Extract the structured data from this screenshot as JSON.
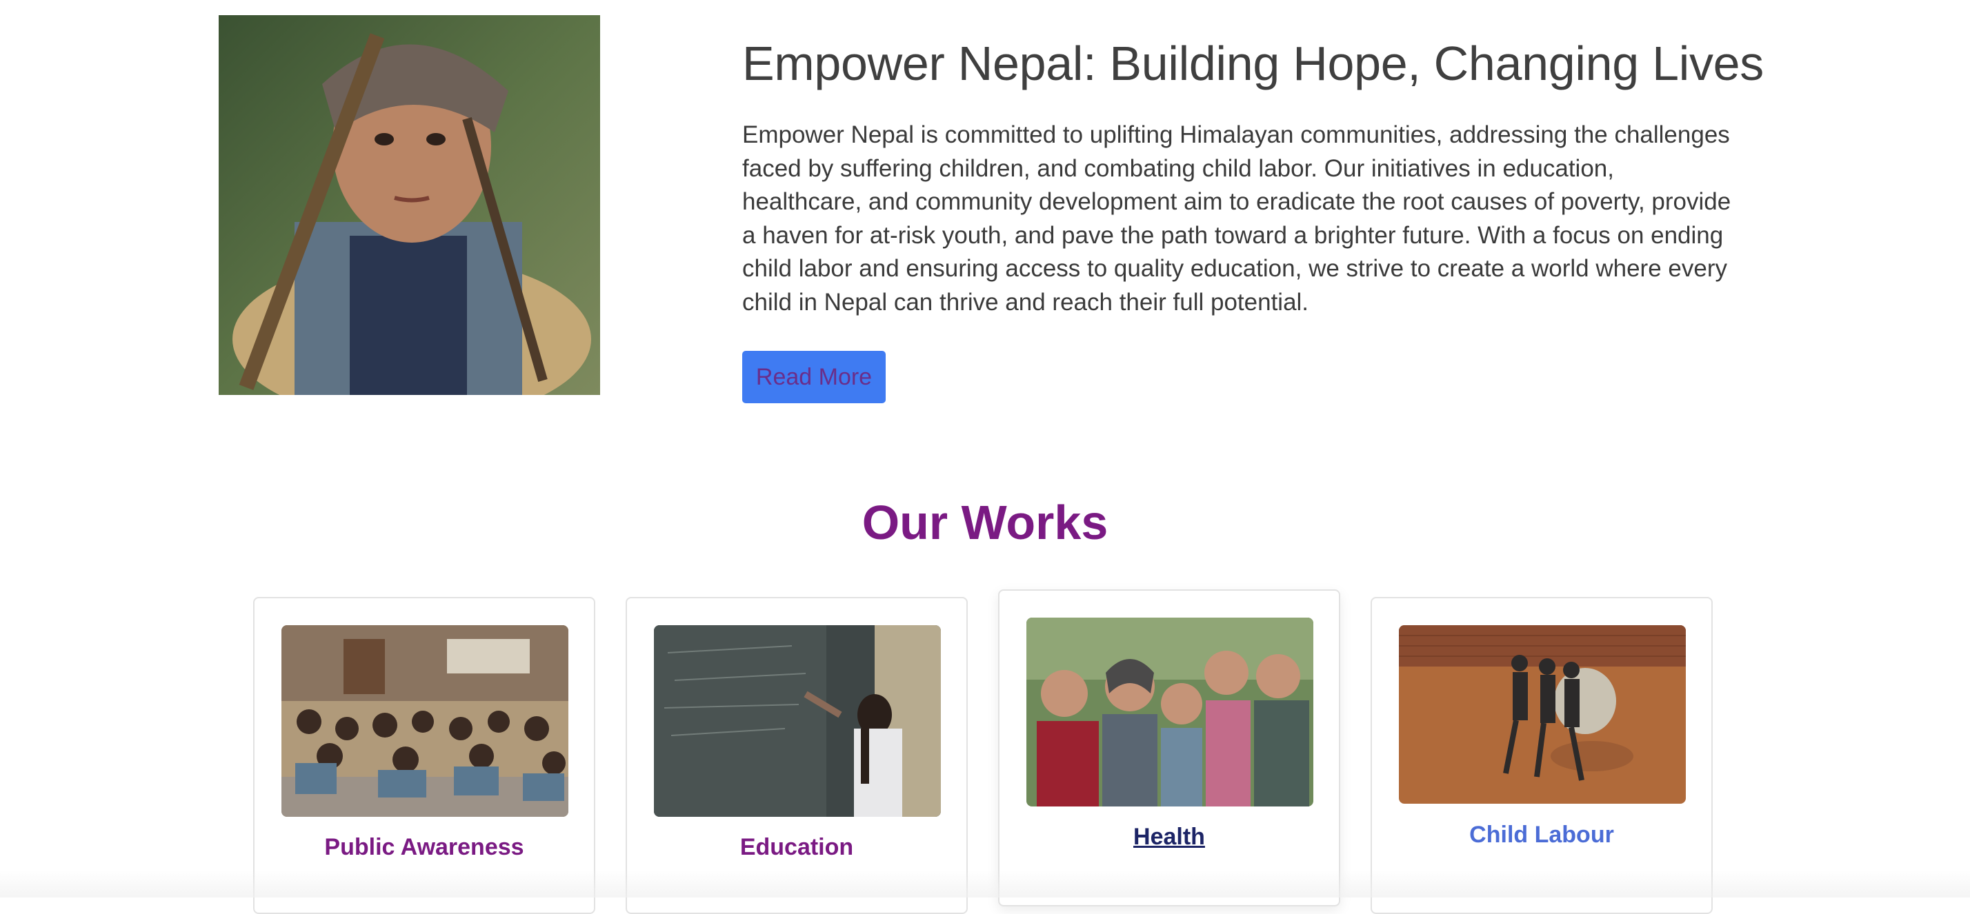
{
  "hero": {
    "title": "Empower Nepal: Building Hope, Changing Lives",
    "description": "Empower Nepal is committed to uplifting Himalayan communities, addressing the challenges faced by suffering children, and combating child labor. Our initiatives in education, healthcare, and community development aim to eradicate the root causes of poverty, provide a haven for at-risk youth, and pave the path toward a brighter future. With a focus on ending child labor and ensuring access to quality education, we strive to create a world where every child in Nepal can thrive and reach their full potential.",
    "button_label": "Read More"
  },
  "works": {
    "title": "Our Works",
    "cards": [
      {
        "label": "Public Awareness"
      },
      {
        "label": "Education"
      },
      {
        "label": "Health"
      },
      {
        "label": "Child Labour"
      }
    ]
  },
  "colors": {
    "accent_purple": "#7a1a83",
    "button_blue": "#3f7bf2",
    "link_dark": "#1c2466",
    "link_blue": "#4b6cd6"
  }
}
